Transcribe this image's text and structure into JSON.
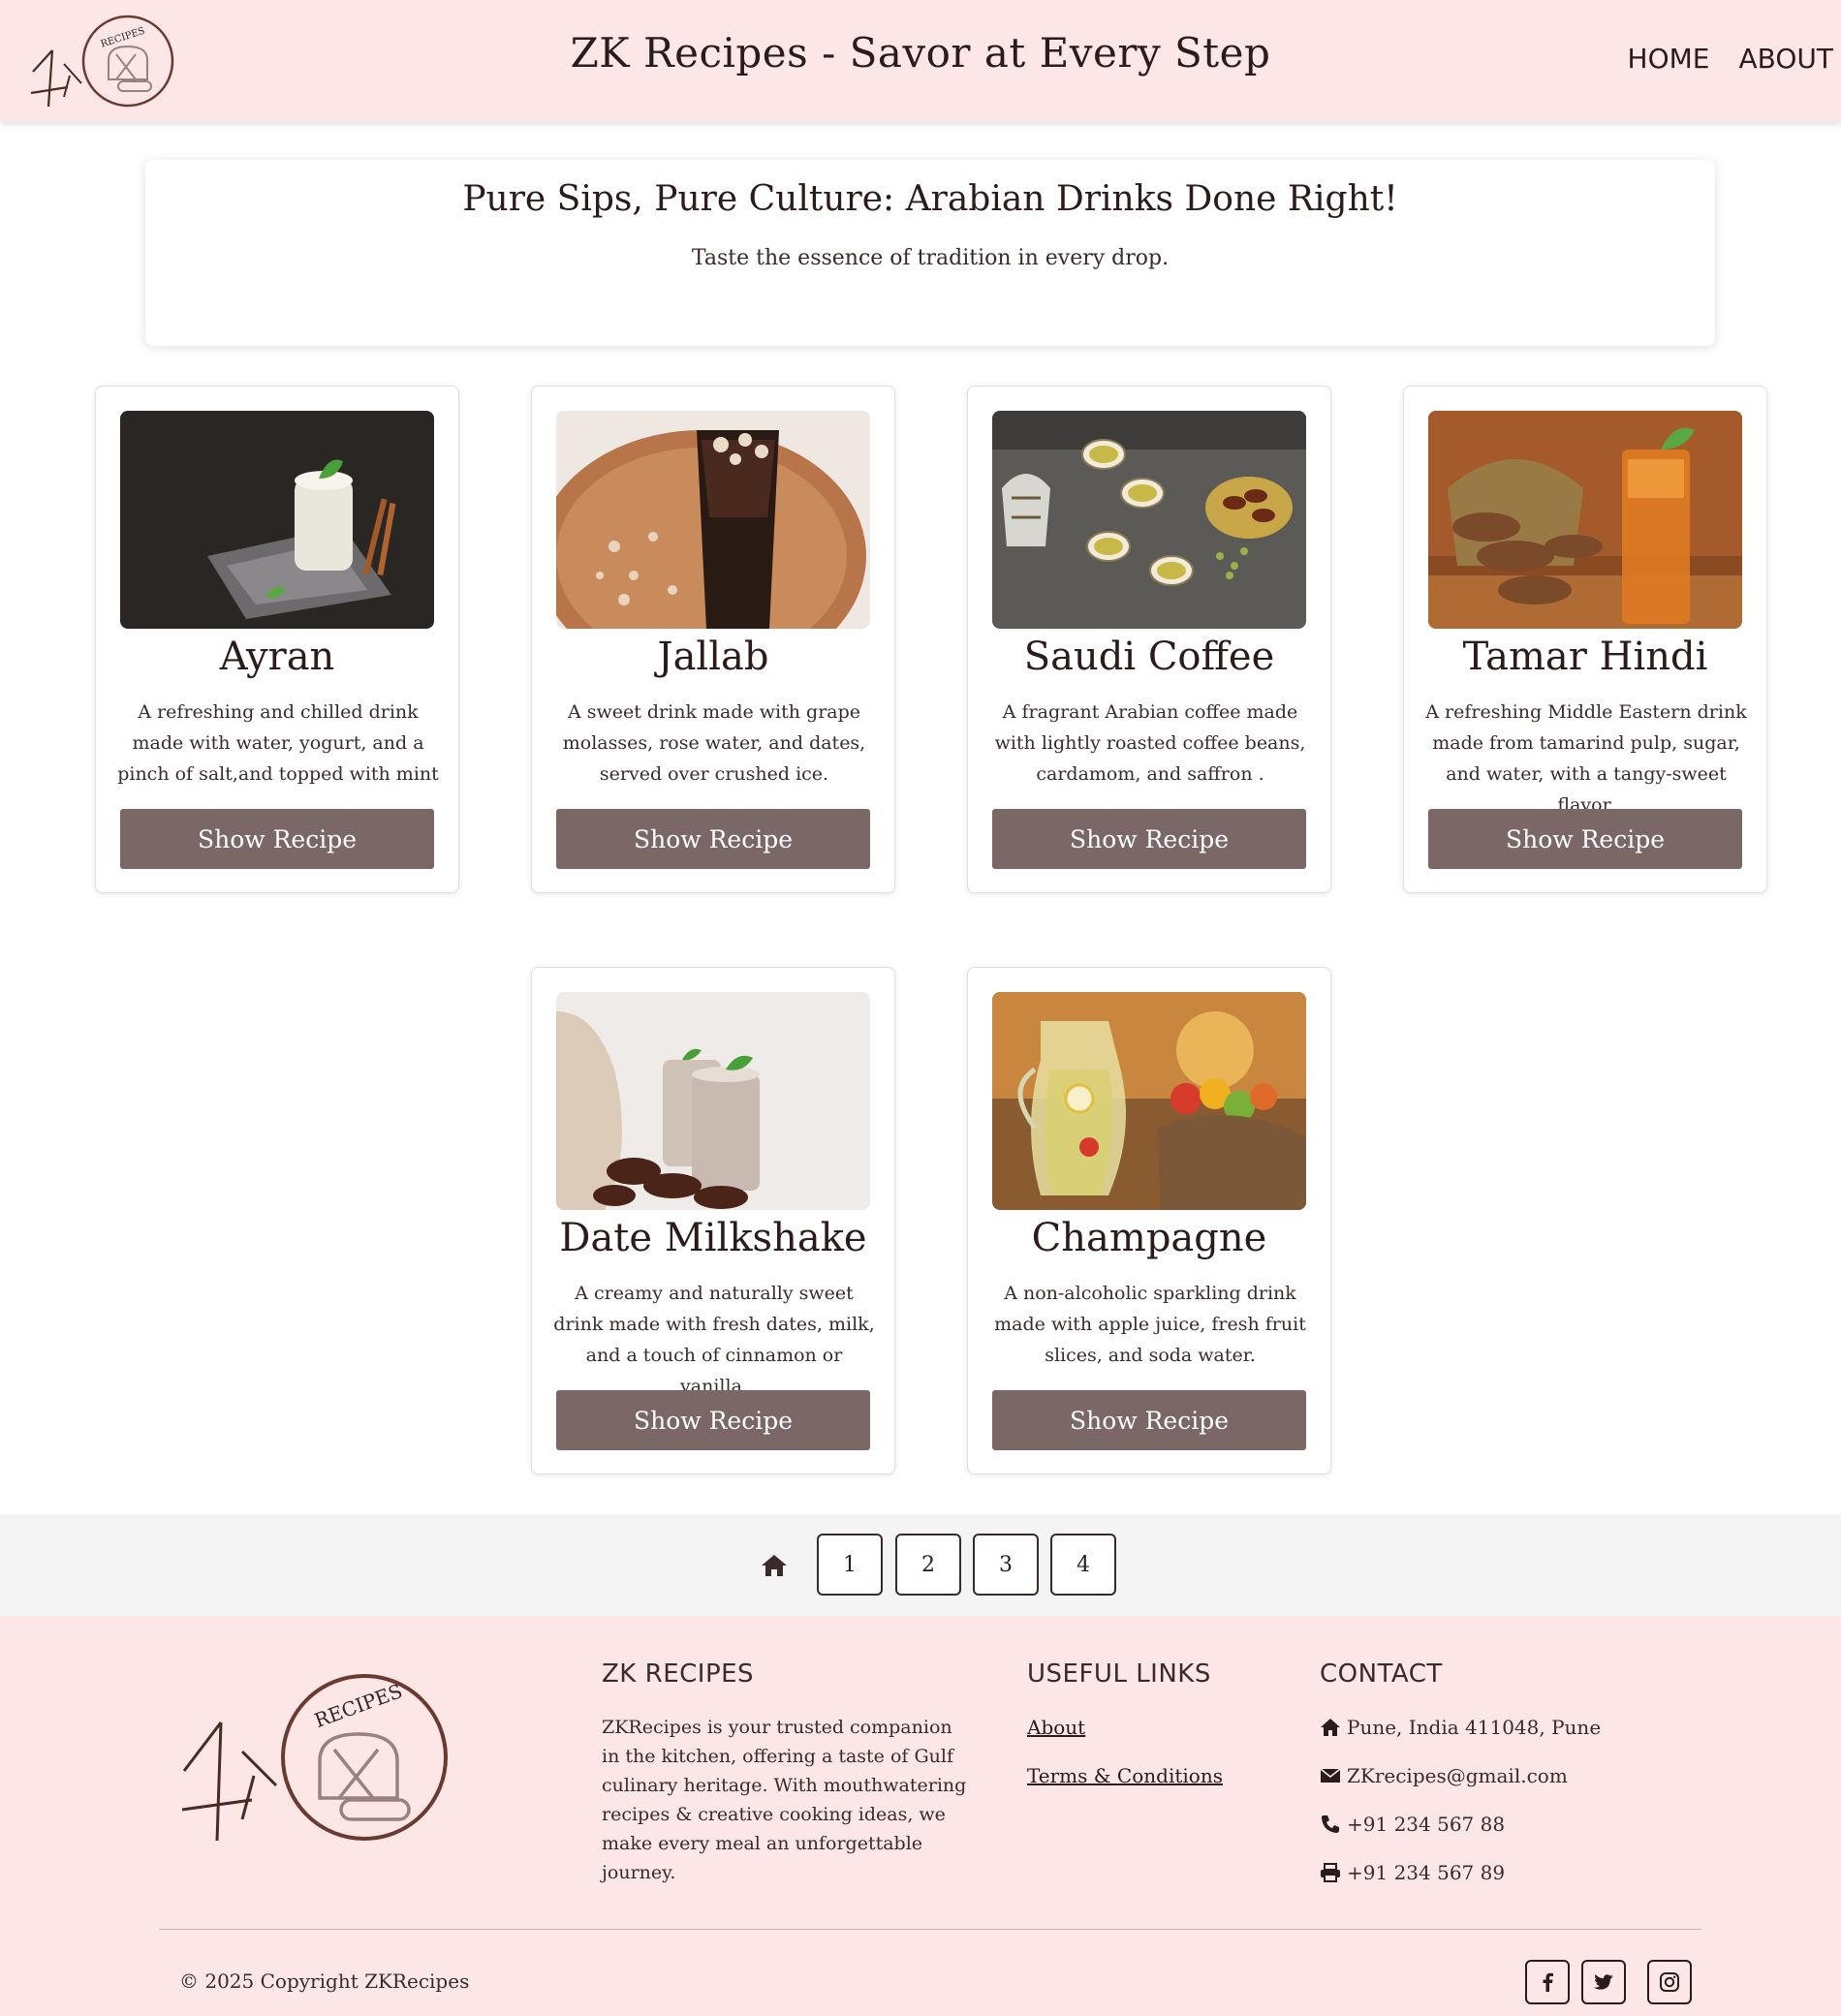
{
  "header": {
    "title": "ZK Recipes - Savor at Every Step",
    "nav": [
      "HOME",
      "ABOUT"
    ]
  },
  "hero": {
    "title": "Pure Sips, Pure Culture: Arabian Drinks Done Right!",
    "subtitle": "Taste the essence of tradition in every drop."
  },
  "cards": [
    {
      "title": "Ayran",
      "desc": "A refreshing and chilled drink made with water, yogurt, and a pinch of salt,and topped with mint",
      "button": "Show Recipe"
    },
    {
      "title": "Jallab",
      "desc": "A sweet drink made with grape molasses, rose water, and dates, served over crushed ice.",
      "button": "Show Recipe"
    },
    {
      "title": "Saudi Coffee",
      "desc": "A fragrant Arabian coffee made with lightly roasted coffee beans, cardamom, and saffron .",
      "button": "Show Recipe"
    },
    {
      "title": "Tamar Hindi",
      "desc": "A refreshing Middle Eastern drink made from tamarind pulp, sugar, and water, with a tangy-sweet flavor.",
      "button": "Show Recipe"
    },
    {
      "title": "Date Milkshake",
      "desc": "A creamy and naturally sweet drink made with fresh dates, milk, and a touch of cinnamon or vanilla.",
      "button": "Show Recipe"
    },
    {
      "title": "Champagne",
      "desc": "A non-alcoholic sparkling drink made with apple juice, fresh fruit slices, and soda water.",
      "button": "Show Recipe"
    }
  ],
  "pagination": {
    "home_icon": "home-icon",
    "pages": [
      "1",
      "2",
      "3",
      "4"
    ]
  },
  "footer": {
    "logo_text": "RECIPES",
    "about_heading": "ZK RECIPES",
    "about_text": "ZKRecipes is your trusted companion in the kitchen, offering a taste of Gulf culinary heritage. With mouthwatering recipes & creative cooking ideas, we make every meal an unforgettable journey.",
    "links_heading": "USEFUL LINKS",
    "links": [
      "About",
      "Terms & Conditions"
    ],
    "contact_heading": "CONTACT",
    "contact": {
      "address": "Pune, India 411048, Pune",
      "email": "ZKrecipes@gmail.com",
      "phone": "+91 234 567 88",
      "fax": "+91 234 567 89"
    },
    "copyright": "© 2025 Copyright ZKRecipes",
    "social": [
      "facebook-icon",
      "twitter-icon",
      "instagram-icon"
    ]
  },
  "colors": {
    "header_bg": "#fce6e6",
    "button_bg": "#7a6766",
    "pagination_bg": "#f4f4f4"
  }
}
